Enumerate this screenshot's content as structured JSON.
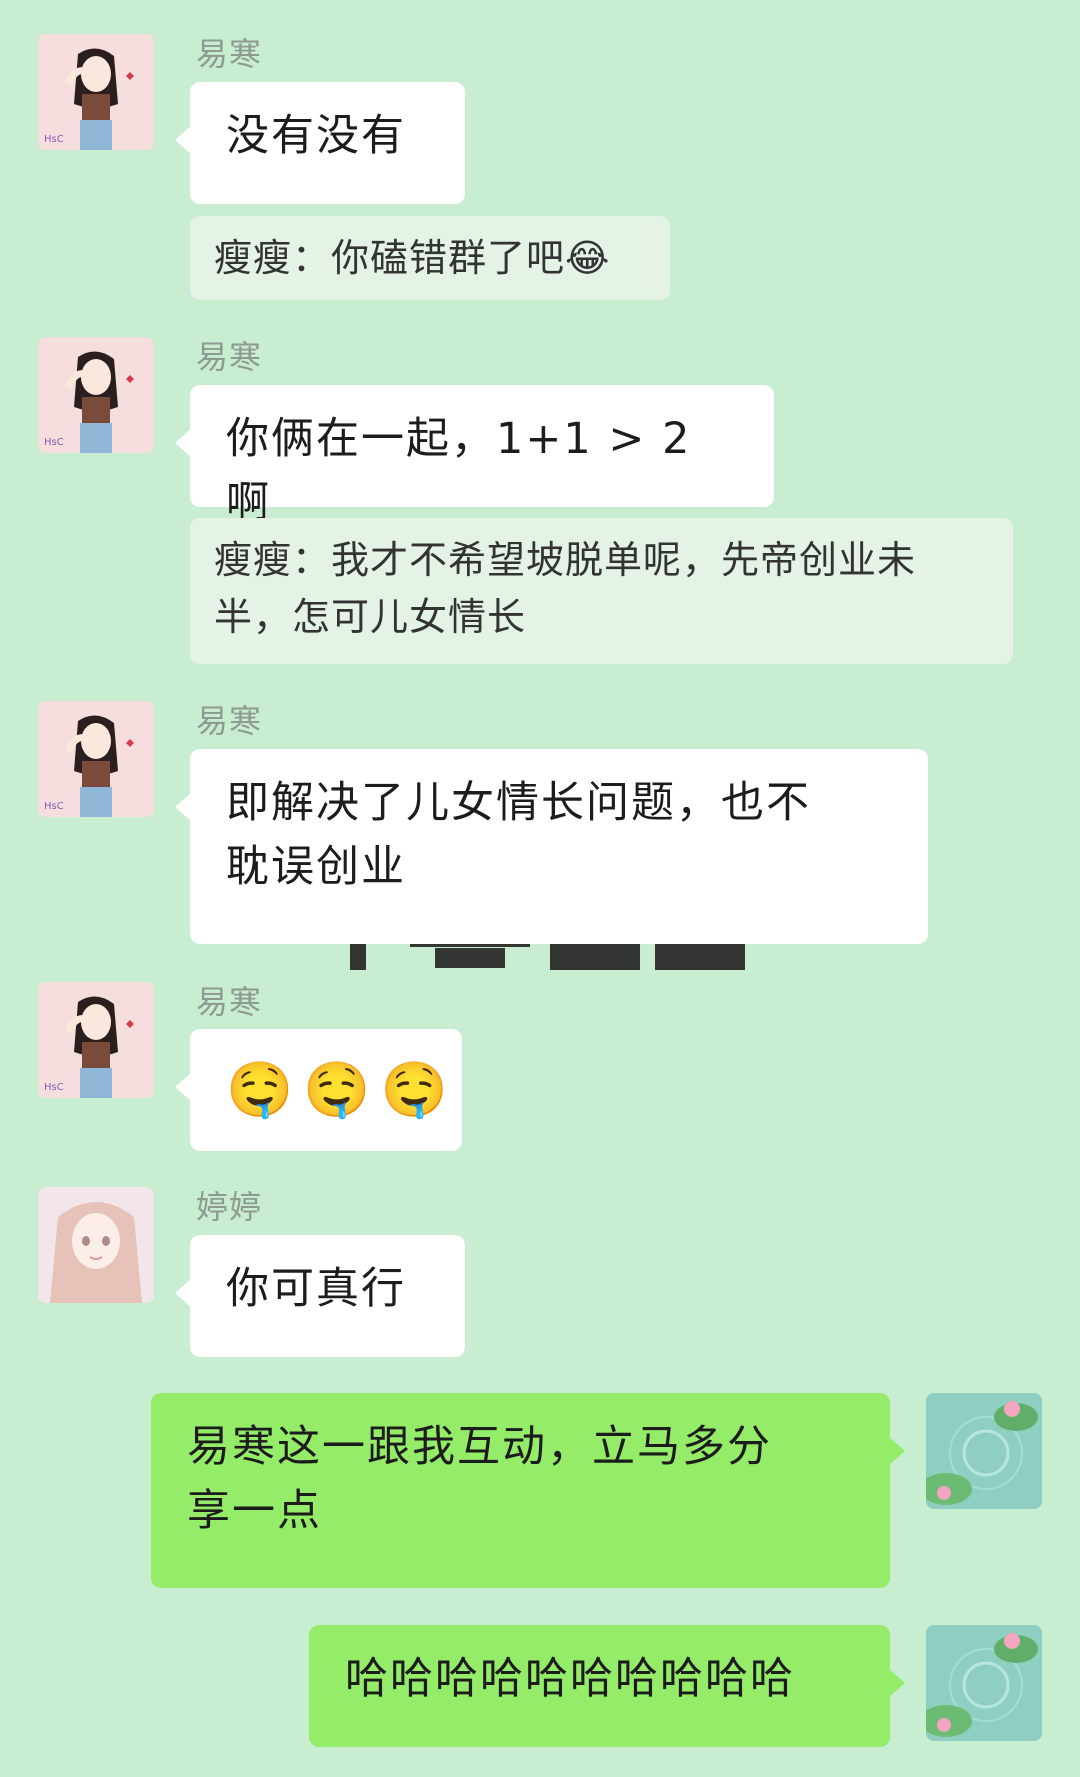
{
  "messages": [
    {
      "sender": "易寒",
      "text": "没有没有"
    },
    {
      "quote": "瘦瘦：你磕错群了吧",
      "quote_emoji": "😂"
    },
    {
      "sender": "易寒",
      "text": "你俩在一起，1+1 > 2 啊"
    },
    {
      "quote_line1": "瘦瘦：我才不希望坡脱单呢，先帝创业未",
      "quote_line2": "半，怎可儿女情长"
    },
    {
      "sender": "易寒",
      "text_line1": "即解决了儿女情长问题，也不",
      "text_line2": "耽误创业"
    },
    {
      "sender": "易寒",
      "emojis": [
        "🤤",
        "🤤",
        "🤤"
      ]
    },
    {
      "sender": "婷婷",
      "text": "你可真行"
    },
    {
      "text_line1": "易寒这一跟我互动，立马多分",
      "text_line2": "享一点"
    },
    {
      "text": "哈哈哈哈哈哈哈哈哈哈"
    }
  ],
  "colors": {
    "background": "#c8edd0",
    "incoming_bubble": "#ffffff",
    "outgoing_bubble": "#95ec69",
    "quote_bubble": "#e4f3e6",
    "sender_name": "#8d9b92"
  },
  "icons": {
    "yihan_avatar": "girl-illustration-avatar",
    "tingting_avatar": "anime-girl-avatar",
    "self_avatar": "lotus-pond-avatar"
  }
}
